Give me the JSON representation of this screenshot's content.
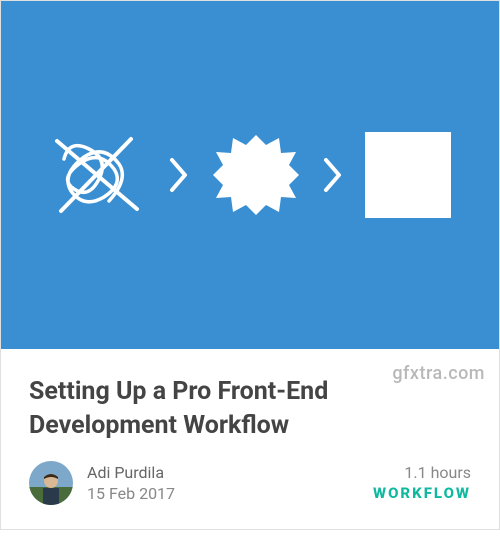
{
  "card": {
    "title": "Setting Up a Pro Front-End Development Workflow",
    "author": {
      "name": "Adi Purdila",
      "date": "15 Feb 2017"
    },
    "duration": "1.1 hours",
    "category": "WORKFLOW",
    "hero_color": "#3a8fd2",
    "accent_color": "#0fb9a0",
    "icons": {
      "stage1": "scribble-icon",
      "sep1": "chevron-right-icon",
      "stage2": "burst-icon",
      "sep2": "chevron-right-icon",
      "stage3": "square-icon"
    }
  },
  "watermark": "gfxtra.com"
}
